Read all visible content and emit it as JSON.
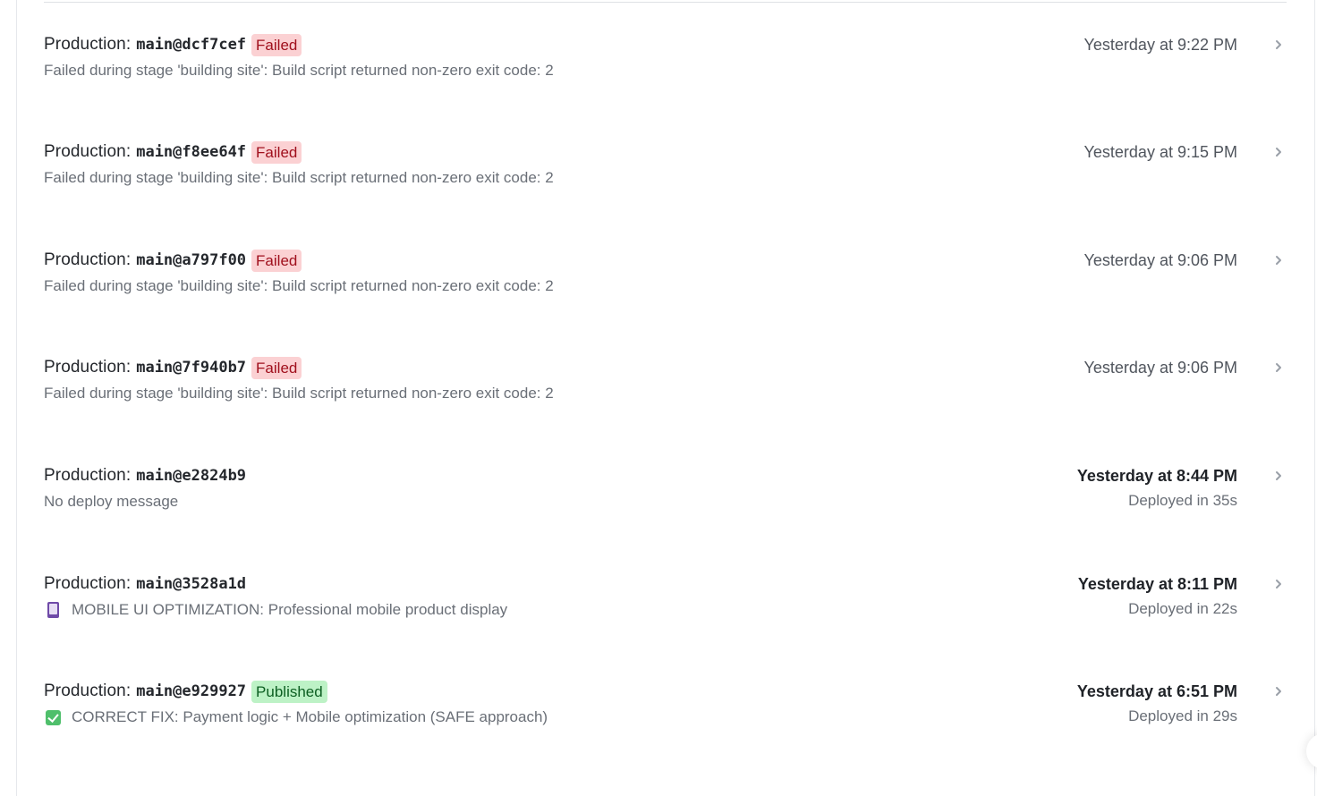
{
  "deploys": [
    {
      "context": "Production:",
      "ref": "main@dcf7cef",
      "badge": "Failed",
      "badge_type": "failed",
      "message": "Failed during stage 'building site': Build script returned non-zero exit code: 2",
      "message_icon": "",
      "time": "Yesterday at 9:22 PM",
      "duration": ""
    },
    {
      "context": "Production:",
      "ref": "main@f8ee64f",
      "badge": "Failed",
      "badge_type": "failed",
      "message": "Failed during stage 'building site': Build script returned non-zero exit code: 2",
      "message_icon": "",
      "time": "Yesterday at 9:15 PM",
      "duration": ""
    },
    {
      "context": "Production:",
      "ref": "main@a797f00",
      "badge": "Failed",
      "badge_type": "failed",
      "message": "Failed during stage 'building site': Build script returned non-zero exit code: 2",
      "message_icon": "",
      "time": "Yesterday at 9:06 PM",
      "duration": ""
    },
    {
      "context": "Production:",
      "ref": "main@7f940b7",
      "badge": "Failed",
      "badge_type": "failed",
      "message": "Failed during stage 'building site': Build script returned non-zero exit code: 2",
      "message_icon": "",
      "time": "Yesterday at 9:06 PM",
      "duration": ""
    },
    {
      "context": "Production:",
      "ref": "main@e2824b9",
      "badge": "",
      "badge_type": "",
      "message": "No deploy message",
      "message_icon": "",
      "time": "Yesterday at 8:44 PM",
      "duration": "Deployed in 35s"
    },
    {
      "context": "Production:",
      "ref": "main@3528a1d",
      "badge": "",
      "badge_type": "",
      "message": "MOBILE UI OPTIMIZATION: Professional mobile product display",
      "message_icon": "mobile-phone-icon",
      "time": "Yesterday at 8:11 PM",
      "duration": "Deployed in 22s"
    },
    {
      "context": "Production:",
      "ref": "main@e929927",
      "badge": "Published",
      "badge_type": "published",
      "message": "CORRECT FIX: Payment logic + Mobile optimization (SAFE approach)",
      "message_icon": "check-mark-icon",
      "time": "Yesterday at 6:51 PM",
      "duration": "Deployed in 29s"
    }
  ],
  "colors": {
    "failed_bg": "#fbd1d3",
    "failed_text": "#a0101d",
    "published_bg": "#bdf2c6",
    "published_text": "#0d5f22",
    "muted_text": "#6a6f77"
  }
}
